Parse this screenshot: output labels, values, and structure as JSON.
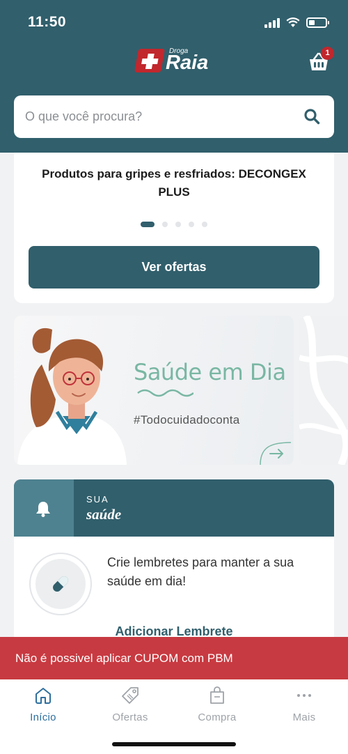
{
  "status_bar": {
    "time": "11:50"
  },
  "header": {
    "logo_small": "Droga",
    "logo_main": "Raia",
    "cart_count": "1"
  },
  "search": {
    "placeholder": "O que você procura?"
  },
  "promo": {
    "title": "Produtos para gripes e resfriados: DECONGEX PLUS",
    "button_label": "Ver ofertas",
    "carousel_pages": 5,
    "carousel_active_index": 0
  },
  "banner": {
    "title": "Saúde em Dia",
    "tagline": "#Todocuidadoconta"
  },
  "health": {
    "kicker": "SUA",
    "title": "saúde",
    "text": "Crie lembretes para manter a sua saúde em dia!",
    "action_label": "Adicionar Lembrete"
  },
  "toast": {
    "message": "Não é possivel aplicar CUPOM com PBM"
  },
  "tabbar": {
    "items": [
      {
        "label": "Início",
        "icon": "home-icon",
        "active": true
      },
      {
        "label": "Ofertas",
        "icon": "tag-icon",
        "active": false
      },
      {
        "label": "Compra",
        "icon": "shopping-bag-icon",
        "active": false
      },
      {
        "label": "Mais",
        "icon": "more-icon",
        "active": false
      }
    ]
  },
  "colors": {
    "brand_teal": "#315f6c",
    "brand_red": "#c1272d",
    "toast_red": "#c83a41",
    "banner_green": "#79b7a3",
    "tab_active": "#2e6f9e"
  }
}
